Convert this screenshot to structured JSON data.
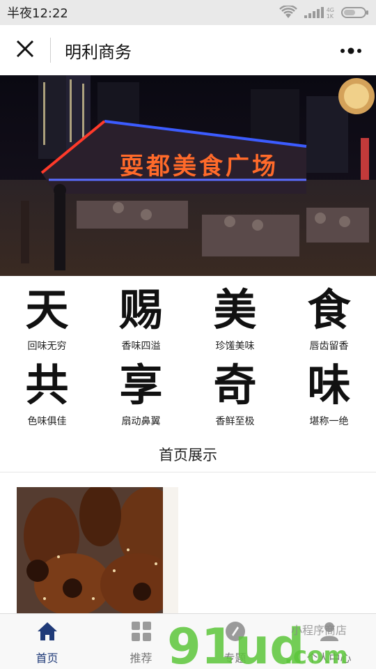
{
  "status_bar": {
    "time": "半夜12:22",
    "network_label": "4G",
    "signal_sub": "1K"
  },
  "header": {
    "title": "明利商务"
  },
  "banner": {
    "sign_text": "耍都美食广场"
  },
  "features": [
    {
      "char": "天",
      "caption": "回味无穷"
    },
    {
      "char": "赐",
      "caption": "香味四溢"
    },
    {
      "char": "美",
      "caption": "珍馐美味"
    },
    {
      "char": "食",
      "caption": "唇齿留香"
    },
    {
      "char": "共",
      "caption": "色味俱佳"
    },
    {
      "char": "享",
      "caption": "扇动鼻翼"
    },
    {
      "char": "奇",
      "caption": "香鲜至极"
    },
    {
      "char": "味",
      "caption": "堪称一绝"
    }
  ],
  "section": {
    "title": "首页展示"
  },
  "tabs": [
    {
      "label": "首页",
      "icon": "home-icon",
      "active": true
    },
    {
      "label": "推荐",
      "icon": "grid-icon",
      "active": false
    },
    {
      "label": "专题",
      "icon": "topic-icon",
      "active": false
    },
    {
      "label": "个人中心",
      "icon": "user-icon",
      "active": false
    }
  ],
  "watermark": {
    "logo_text": "91ud",
    "suffix": ".com",
    "tagline": "小程序商店"
  },
  "colors": {
    "accent": "#1f3a78",
    "status_bar_bg": "#e9e9e9",
    "tab_bar_bg": "#f8f8f8",
    "watermark_green": "#5cc63a"
  }
}
